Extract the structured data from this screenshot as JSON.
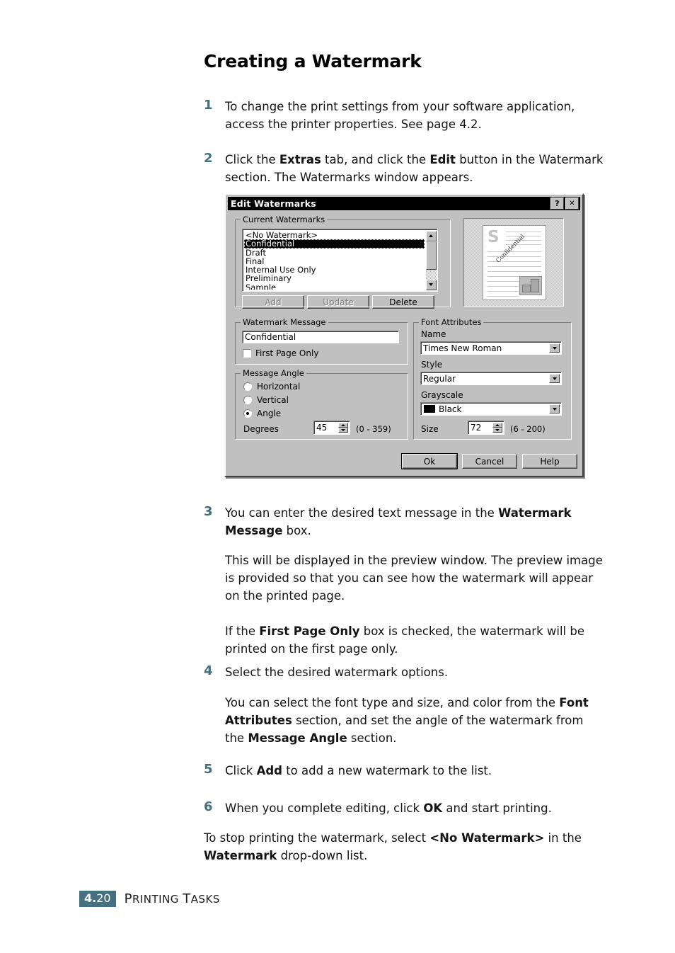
{
  "document": {
    "heading": "Creating a Watermark",
    "steps": [
      {
        "num": "1",
        "html": "To change the print settings from your software application, access the printer properties. See page 4.2."
      },
      {
        "num": "2",
        "html": "Click the <b>Extras</b> tab, and click the <b>Edit</b> button in the Watermark section. The Watermarks window appears."
      },
      {
        "num": "3",
        "html": "You can enter the desired text message in the <b>Watermark Message</b> box."
      },
      {
        "num": "4",
        "html": "Select the desired watermark options."
      },
      {
        "num": "5",
        "html": "Click <b>Add</b> to add a new watermark to the list."
      },
      {
        "num": "6",
        "html": "When you complete editing, click <b>OK</b> and start printing."
      }
    ],
    "paragraphs": {
      "p3a": "This will be displayed in the preview window. The preview image is provided so that you can see how the watermark will appear on the printed page.",
      "p3b": "If the <b>First Page Only</b> box is checked, the watermark will be printed on the first page only.",
      "p4a": "You can select the font type and size, and color from the <b>Font Attributes</b> section, and set the angle of the watermark from the <b>Message Angle</b> section.",
      "p6a": "To stop printing the watermark, select <b>&lt;No Watermark&gt;</b> in the <b>Watermark</b> drop-down list."
    },
    "footer": {
      "page_major": "4.",
      "page_minor": "20",
      "section_first": "P",
      "section_rest": "RINTING ",
      "section_second": "T",
      "section_rest2": "ASKS",
      "accent_color": "#44707f"
    }
  },
  "dialog": {
    "title": "Edit Watermarks",
    "titlebar_buttons": {
      "help": "?",
      "close": "✕"
    },
    "current_watermarks": {
      "label": "Current Watermarks",
      "items": [
        "<No Watermark>",
        "Confidential",
        "Draft",
        "Final",
        "Internal Use Only",
        "Preliminary",
        "Sample"
      ],
      "selected_index": 1,
      "buttons": {
        "add": "Add",
        "update": "Update",
        "delete": "Delete"
      }
    },
    "preview": {
      "logo_letter": "S",
      "watermark_text": "Confidential"
    },
    "watermark_message": {
      "label": "Watermark Message",
      "value": "Confidential",
      "first_page_only_label": "First Page Only",
      "first_page_only_checked": false
    },
    "message_angle": {
      "label": "Message Angle",
      "options": [
        "Horizontal",
        "Vertical",
        "Angle"
      ],
      "selected": "Angle",
      "degrees_label": "Degrees",
      "degrees_value": "45",
      "degrees_range": "(0 - 359)"
    },
    "font_attributes": {
      "label": "Font Attributes",
      "name_label": "Name",
      "name_value": "Times New Roman",
      "style_label": "Style",
      "style_value": "Regular",
      "grayscale_label": "Grayscale",
      "grayscale_value": "Black",
      "grayscale_swatch": "#000000",
      "size_label": "Size",
      "size_value": "72",
      "size_range": "(6 - 200)"
    },
    "footer_buttons": {
      "ok": "Ok",
      "cancel": "Cancel",
      "help": "Help"
    }
  }
}
